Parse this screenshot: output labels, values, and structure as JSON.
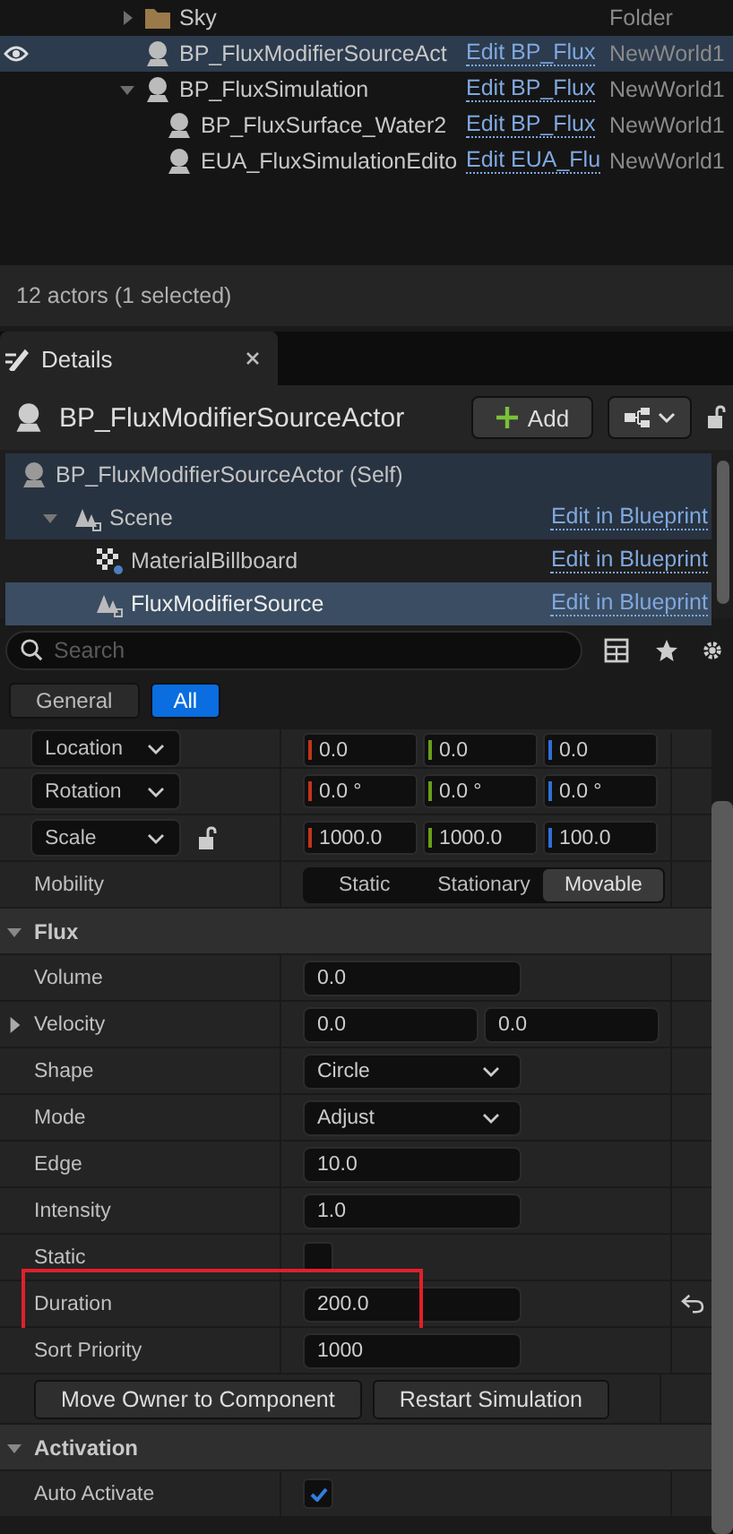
{
  "outliner": {
    "rows": [
      {
        "name": "Sky",
        "type": "Folder",
        "kind": "folder",
        "selected": false,
        "expanded": false
      },
      {
        "name": "BP_FluxModifierSourceAct",
        "link": "Edit BP_Flux",
        "world": "NewWorld1",
        "kind": "actor",
        "selected": true
      },
      {
        "name": "BP_FluxSimulation",
        "link": "Edit BP_Flux",
        "world": "NewWorld1",
        "kind": "actor",
        "selected": false,
        "expanded": true,
        "children": [
          {
            "name": "BP_FluxSurface_Water2",
            "link": "Edit BP_Flux",
            "world": "NewWorld1",
            "kind": "actor",
            "selected": false
          },
          {
            "name": "EUA_FluxSimulationEdito",
            "link": "Edit EUA_Flu",
            "world": "NewWorld1",
            "kind": "actor",
            "selected": false
          }
        ]
      }
    ],
    "status": "12 actors (1 selected)"
  },
  "details": {
    "tab": "Details",
    "title": "BP_FluxModifierSourceActor",
    "add_label": "Add",
    "components": [
      {
        "name": "BP_FluxModifierSourceActor (Self)",
        "kind": "actor",
        "selected": false,
        "children": [
          {
            "name": "Scene",
            "link": "Edit in Blueprint",
            "kind": "scene",
            "selected": false,
            "expanded": true,
            "children": [
              {
                "name": "MaterialBillboard",
                "link": "Edit in Blueprint",
                "kind": "billboard",
                "selected": false
              },
              {
                "name": "FluxModifierSource",
                "link": "Edit in Blueprint",
                "kind": "scene",
                "selected": true
              }
            ]
          }
        ]
      }
    ],
    "search": {
      "placeholder": "Search"
    },
    "filters": [
      {
        "label": "General",
        "selected": false
      },
      {
        "label": "All",
        "selected": true
      }
    ],
    "properties": [
      {
        "kind": "transform",
        "label": "Location",
        "values": [
          "0.0",
          "0.0",
          "0.0"
        ]
      },
      {
        "kind": "transform",
        "label": "Rotation",
        "values": [
          "0.0 °",
          "0.0 °",
          "0.0 °"
        ]
      },
      {
        "kind": "transform",
        "label": "Scale",
        "locked": false,
        "values": [
          "1000.0",
          "1000.0",
          "100.0"
        ]
      },
      {
        "kind": "segmented",
        "label": "Mobility",
        "options": [
          {
            "label": "Static",
            "selected": false
          },
          {
            "label": "Stationary",
            "selected": false
          },
          {
            "label": "Movable",
            "selected": true
          }
        ]
      },
      {
        "kind": "category",
        "label": "Flux",
        "expanded": true
      },
      {
        "kind": "number",
        "label": "Volume",
        "value": "0.0",
        "modified": false,
        "highlighted": false
      },
      {
        "kind": "vector2",
        "label": "Velocity",
        "expanded": false,
        "values": [
          "0.0",
          "0.0"
        ]
      },
      {
        "kind": "dropdown",
        "label": "Shape",
        "value": "Circle"
      },
      {
        "kind": "dropdown",
        "label": "Mode",
        "value": "Adjust"
      },
      {
        "kind": "number",
        "label": "Edge",
        "value": "10.0",
        "modified": false,
        "highlighted": false
      },
      {
        "kind": "number",
        "label": "Intensity",
        "value": "1.0",
        "modified": false,
        "highlighted": false
      },
      {
        "kind": "checkbox",
        "label": "Static",
        "checked": false
      },
      {
        "kind": "number",
        "label": "Duration",
        "value": "200.0",
        "modified": true,
        "highlighted": true
      },
      {
        "kind": "number",
        "label": "Sort Priority",
        "value": "1000",
        "modified": false,
        "highlighted": false
      },
      {
        "kind": "buttons",
        "buttons": [
          "Move Owner to Component",
          "Restart Simulation"
        ]
      },
      {
        "kind": "category",
        "label": "Activation",
        "expanded": true
      },
      {
        "kind": "checkbox",
        "label": "Auto Activate",
        "checked": true
      }
    ]
  }
}
